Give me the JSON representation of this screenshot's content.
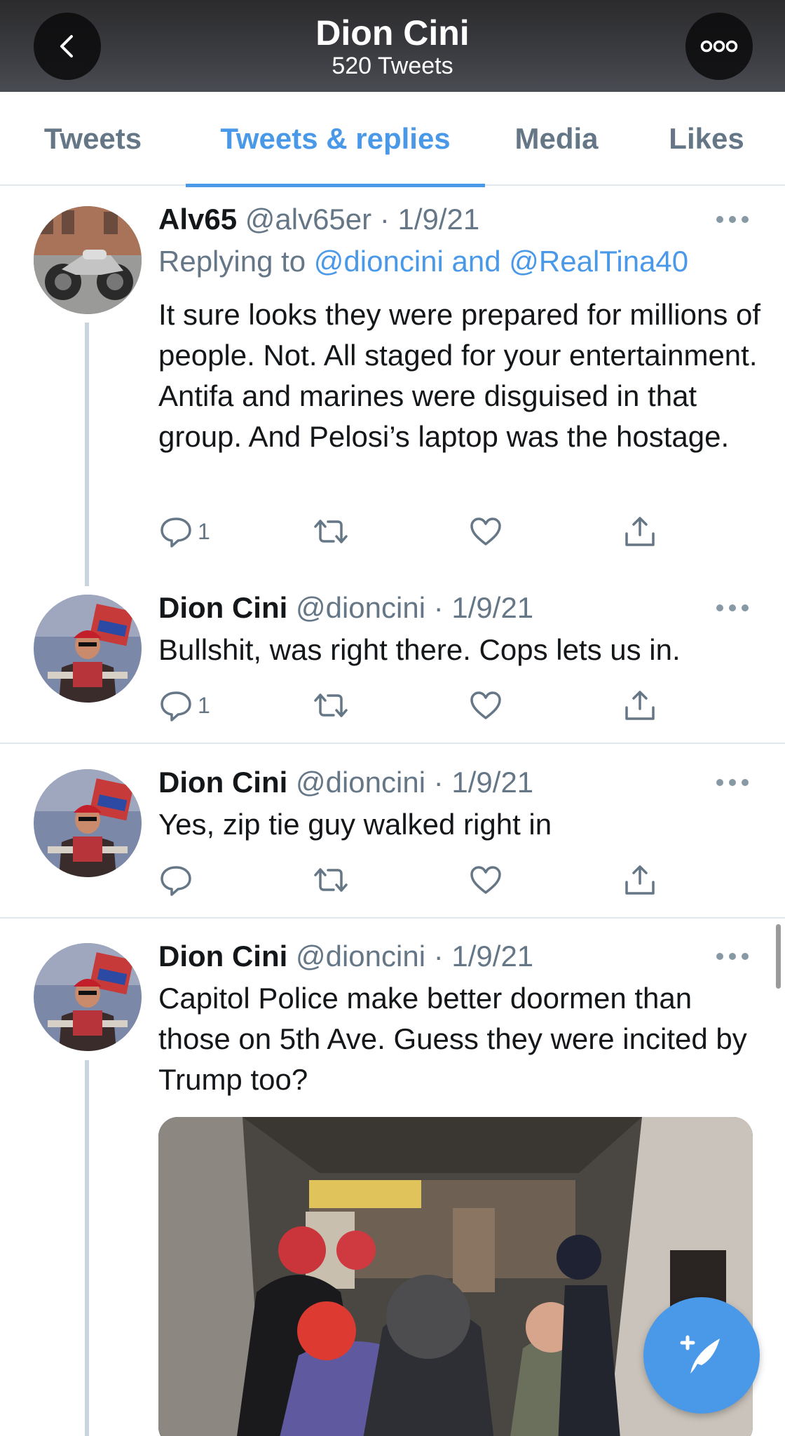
{
  "header": {
    "title": "Dion Cini",
    "subtitle": "520 Tweets"
  },
  "tabs": [
    {
      "label": "Tweets",
      "active": false
    },
    {
      "label": "Tweets & replies",
      "active": true
    },
    {
      "label": "Media",
      "active": false
    },
    {
      "label": "Likes",
      "active": false
    }
  ],
  "tweets": [
    {
      "name": "Alv65",
      "handle": "@alv65er",
      "dot": "·",
      "date": "1/9/21",
      "replying_prefix": "Replying to",
      "replying_mentions": "@dioncini and @RealTina40",
      "text": "It sure looks they were prepared for millions of people. Not. All staged for your entertainment. Antifa and marines were disguised in that group. And Pelosi’s laptop was the hostage.",
      "reply_count": "1"
    },
    {
      "name": "Dion Cini",
      "handle": "@dioncini",
      "dot": "·",
      "date": "1/9/21",
      "text": "Bullshit, was right there. Cops lets us in.",
      "reply_count": "1"
    },
    {
      "name": "Dion Cini",
      "handle": "@dioncini",
      "dot": "·",
      "date": "1/9/21",
      "text": "Yes, zip tie guy walked right in",
      "reply_count": ""
    },
    {
      "name": "Dion Cini",
      "handle": "@dioncini",
      "dot": "·",
      "date": "1/9/21",
      "text": "Capitol Police make better doormen than those on 5th Ave. Guess they were incited by Trump too?",
      "reply_count": ""
    }
  ],
  "icons": {
    "back": "chevron-left-icon",
    "more": "more-icon",
    "reply": "reply-icon",
    "retweet": "retweet-icon",
    "like": "heart-icon",
    "share": "share-icon",
    "compose": "compose-tweet-icon"
  },
  "colors": {
    "accent": "#4a99e9",
    "secondary_text": "#657786",
    "divider": "#e1e8ed"
  }
}
